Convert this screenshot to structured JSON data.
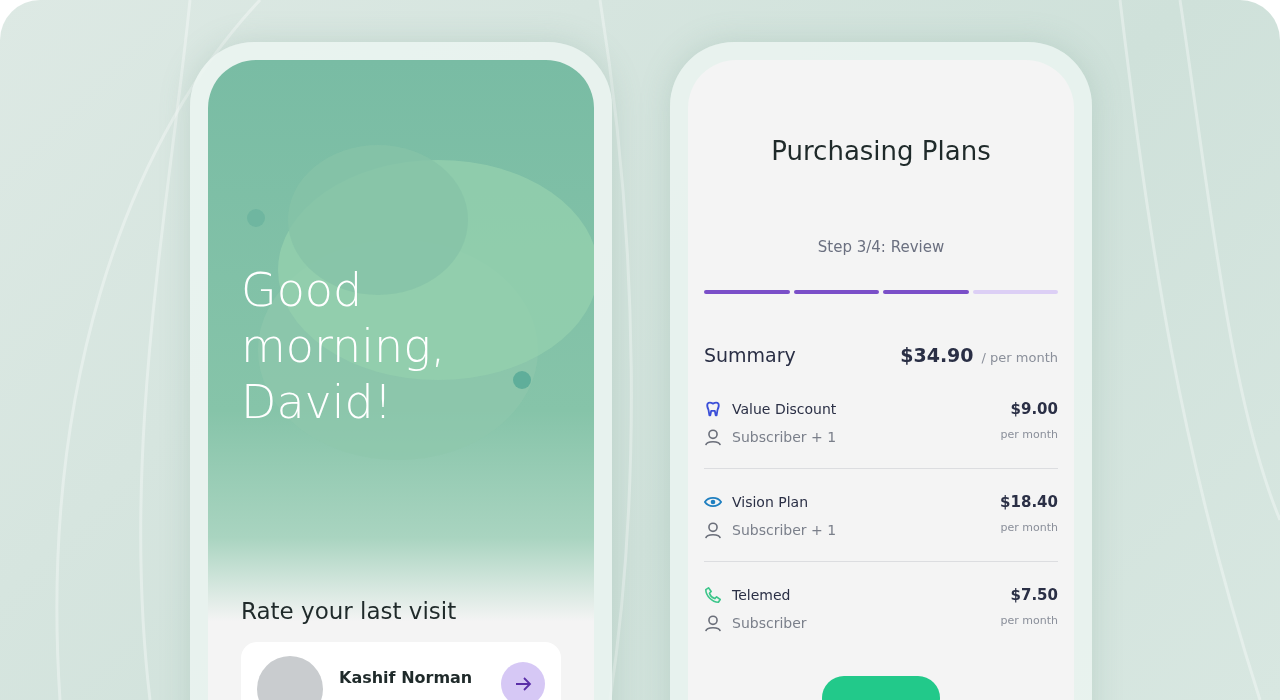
{
  "greeting_screen": {
    "greeting": "Good morning, David!",
    "section_title": "Rate your last visit",
    "visit_card": {
      "name": "Kashif Norman"
    }
  },
  "plans_screen": {
    "title": "Purchasing Plans",
    "step_label": "Step 3/4: Review",
    "steps": [
      {
        "completed": true
      },
      {
        "completed": true
      },
      {
        "completed": true
      },
      {
        "completed": false
      }
    ],
    "summary": {
      "label": "Summary",
      "total": "$34.90",
      "period": "/ per month"
    },
    "plans": [
      {
        "kind": "dental",
        "name": "Value Discount",
        "members": "Subscriber + 1",
        "price": "$9.00",
        "period": "per month"
      },
      {
        "kind": "vision",
        "name": "Vision Plan",
        "members": "Subscriber + 1",
        "price": "$18.40",
        "period": "per month"
      },
      {
        "kind": "telemed",
        "name": "Telemed",
        "members": "Subscriber",
        "price": "$7.50",
        "period": "per month"
      }
    ]
  }
}
